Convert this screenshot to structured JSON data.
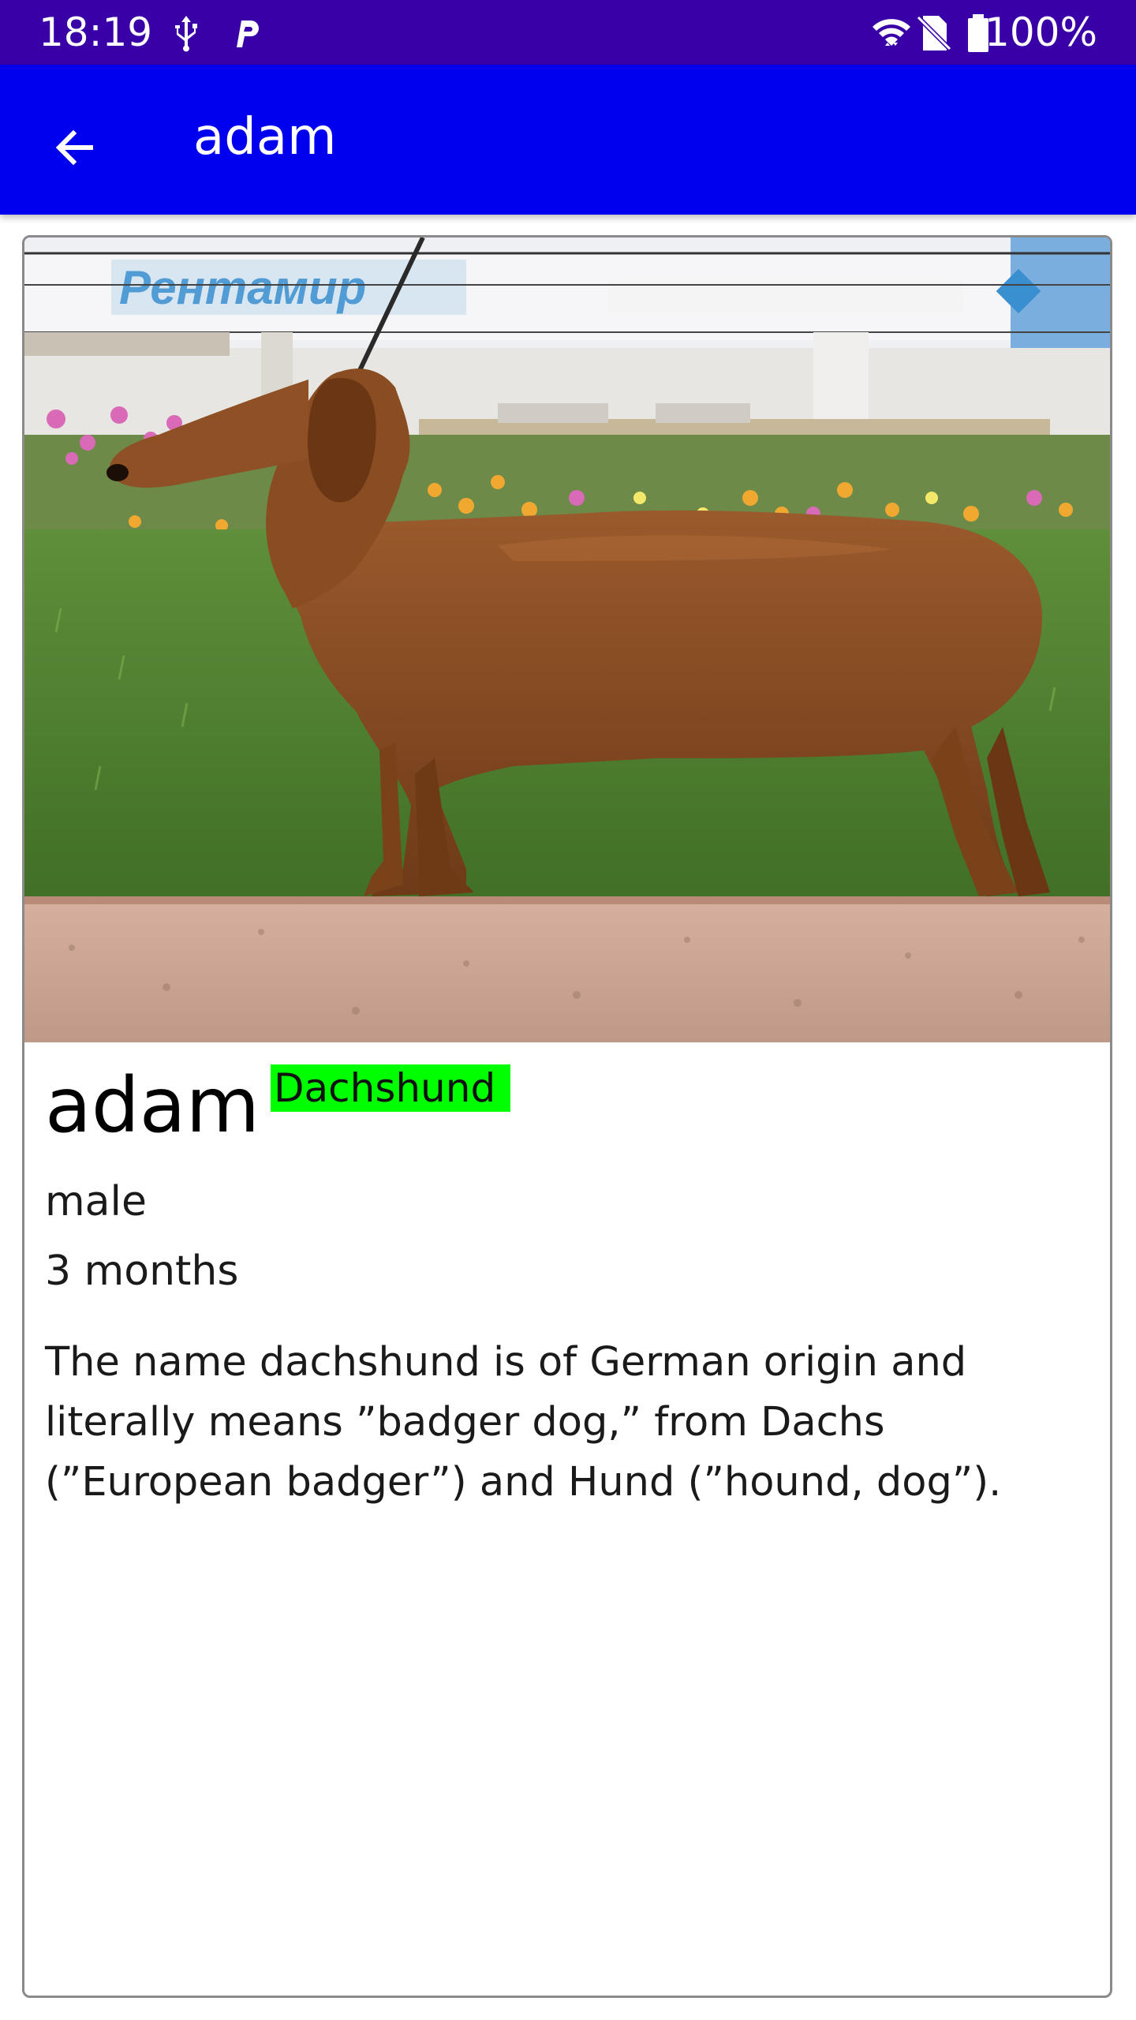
{
  "status_bar": {
    "time": "18:19",
    "battery_text": "100%",
    "icons": [
      "usb-icon",
      "parking-app-icon",
      "wifi-icon",
      "no-sim-icon",
      "battery-icon"
    ]
  },
  "app_bar": {
    "title": "adam",
    "back_icon": "arrow-left-icon",
    "background": "#0000ee"
  },
  "pet": {
    "name": "adam",
    "breed": "Dachshund",
    "gender": "male",
    "age": "3 months",
    "description": "The name dachshund is of German origin and literally means ”badger dog,” from Dachs (”European badger”) and Hund (”hound, dog”).",
    "photo_subject": "dachshund-photo"
  },
  "colors": {
    "status_bar": "#3a00a8",
    "app_bar": "#0000ee",
    "breed_badge": "#00ff00"
  }
}
